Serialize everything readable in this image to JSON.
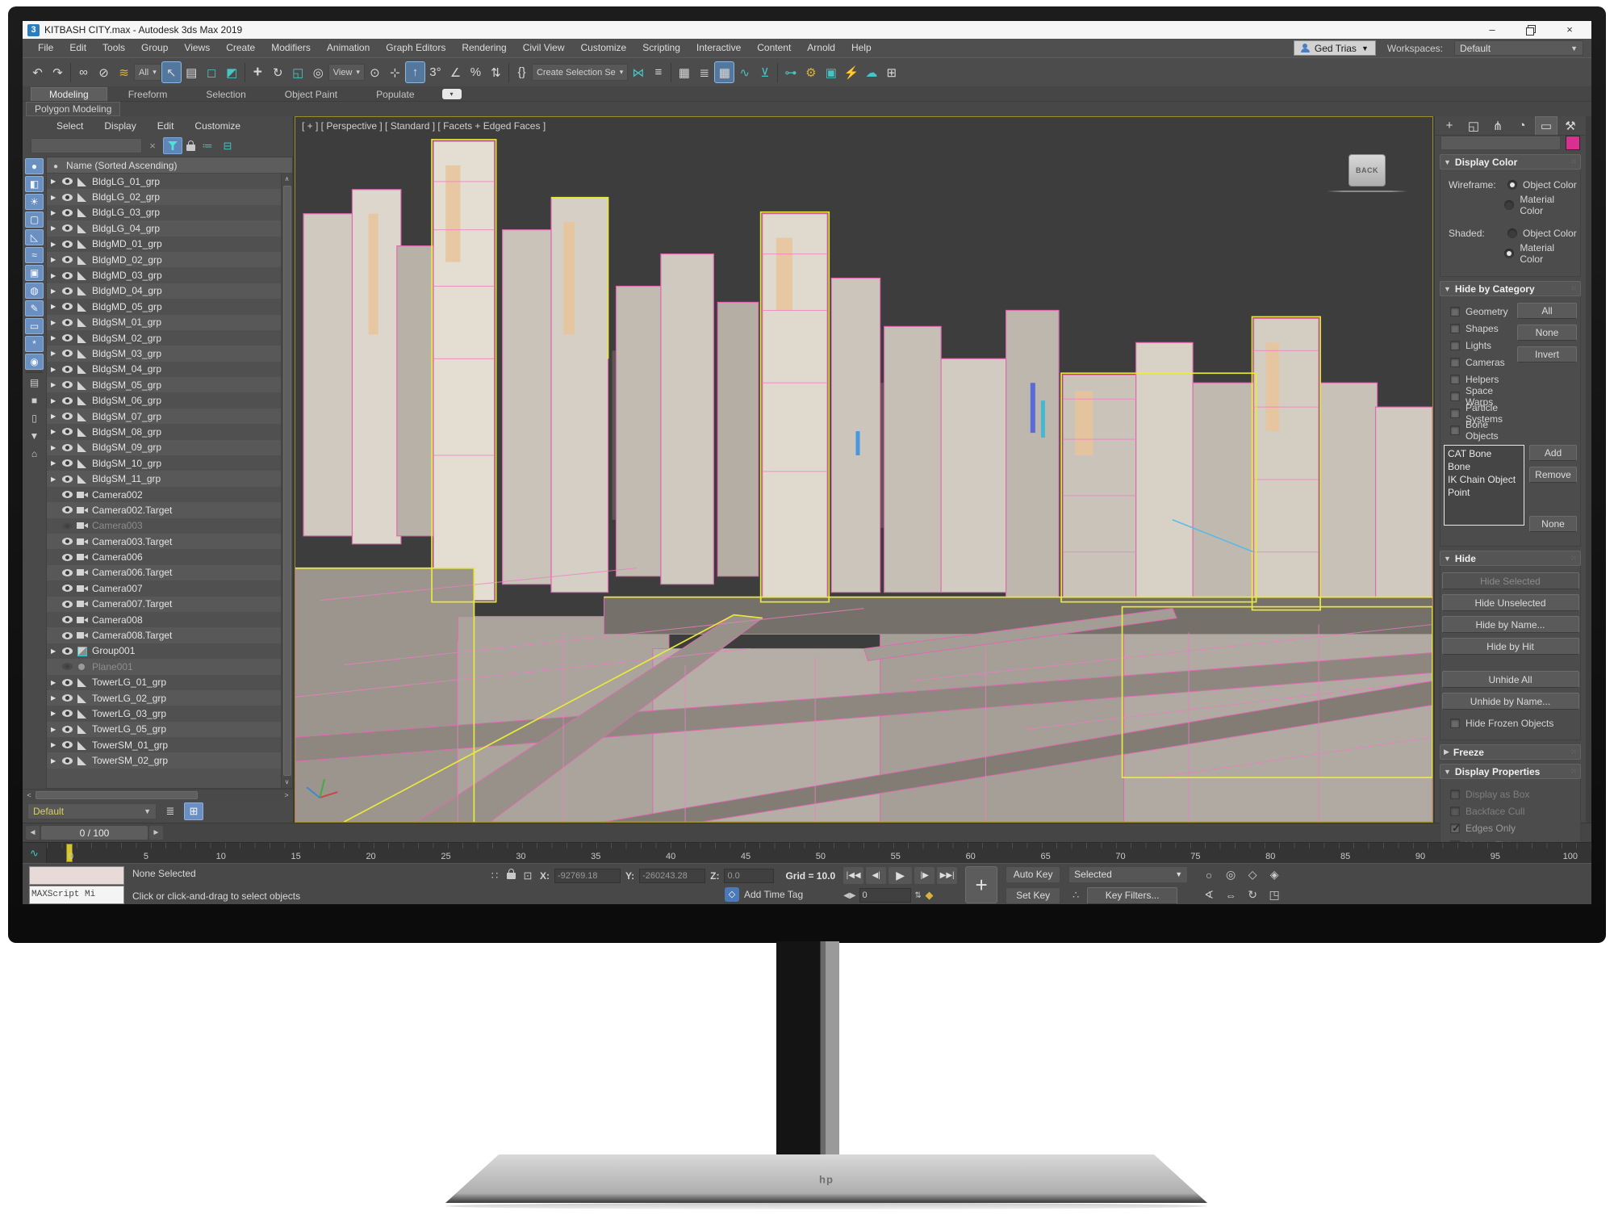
{
  "colors": {
    "accent_blue": "#6a90c2",
    "teal": "#49c3c3",
    "magenta_swatch": "#d92f8f",
    "selection_yellow": "#e9e93c",
    "wire_pink": "#e06ab0",
    "timeline_marker": "#d6c62e"
  },
  "titlebar": {
    "app_glyph": "3",
    "title": "KITBASH CITY.max - Autodesk 3ds Max 2019"
  },
  "menubar": {
    "items": [
      "File",
      "Edit",
      "Tools",
      "Group",
      "Views",
      "Create",
      "Modifiers",
      "Animation",
      "Graph Editors",
      "Rendering",
      "Civil View",
      "Customize",
      "Scripting",
      "Interactive",
      "Content",
      "Arnold",
      "Help"
    ],
    "user": "Ged Trias",
    "workspaces_label": "Workspaces:",
    "workspace": "Default"
  },
  "toolbar": {
    "items": [
      {
        "g": "↶",
        "n": "undo-icon"
      },
      {
        "g": "↷",
        "n": "redo-icon"
      },
      {
        "g": "",
        "n": "separator",
        "c": "sep"
      },
      {
        "g": "∞",
        "n": "select-and-link-icon"
      },
      {
        "g": "⊘",
        "n": "unlink-selection-icon"
      },
      {
        "g": "≋",
        "n": "bind-to-space-warp-icon",
        "c": "yel"
      },
      {
        "g": "All",
        "n": "selection-filter-dropdown",
        "c": "dd w60"
      },
      {
        "g": "↖",
        "n": "select-object-icon",
        "c": "hl"
      },
      {
        "g": "▤",
        "n": "select-by-name-icon"
      },
      {
        "g": "◻",
        "n": "rectangular-selection-region-icon",
        "c": "teal"
      },
      {
        "g": "◩",
        "n": "crossing-selection-icon",
        "c": "teal"
      },
      {
        "g": "",
        "n": "separator",
        "c": "sep"
      },
      {
        "g": "+",
        "n": "select-and-move-icon",
        "c": "big"
      },
      {
        "g": "↻",
        "n": "select-and-rotate-icon"
      },
      {
        "g": "◱",
        "n": "select-and-scale-icon",
        "c": "teal"
      },
      {
        "g": "◎",
        "n": "select-and-place-icon"
      },
      {
        "g": "View",
        "n": "reference-coordinate-dropdown",
        "c": "dd w74"
      },
      {
        "g": "⊙",
        "n": "use-pivot-center-icon"
      },
      {
        "g": "⊹",
        "n": "select-and-manipulate-icon"
      },
      {
        "g": "↑",
        "n": "keyboard-shortcut-override-icon",
        "c": "hl"
      },
      {
        "g": "3°",
        "n": "snaps-toggle-3d-icon"
      },
      {
        "g": "∠",
        "n": "angle-snap-icon"
      },
      {
        "g": "%",
        "n": "percent-snap-icon"
      },
      {
        "g": "⇅",
        "n": "spinner-snap-icon"
      },
      {
        "g": "",
        "n": "separator",
        "c": "sep"
      },
      {
        "g": "{}",
        "n": "edit-named-selection-sets-icon"
      },
      {
        "g": "Create Selection Se",
        "n": "named-selection-set-dropdown",
        "c": "dd w128"
      },
      {
        "g": "⋈",
        "n": "mirror-icon",
        "c": "teal"
      },
      {
        "g": "≡",
        "n": "align-icon"
      },
      {
        "g": "",
        "n": "separator",
        "c": "sep"
      },
      {
        "g": "▦",
        "n": "toggle-scene-explorer-icon"
      },
      {
        "g": "≣",
        "n": "toggle-layer-explorer-icon"
      },
      {
        "g": "▦",
        "n": "toggle-ribbon-icon",
        "c": "hl"
      },
      {
        "g": "∿",
        "n": "curve-editor-icon",
        "c": "teal"
      },
      {
        "g": "⊻",
        "n": "schematic-view-icon",
        "c": "teal"
      },
      {
        "g": "",
        "n": "separator",
        "c": "sep"
      },
      {
        "g": "⊶",
        "n": "material-editor-icon",
        "c": "teal"
      },
      {
        "g": "⚙",
        "n": "render-setup-icon",
        "c": "yel"
      },
      {
        "g": "▣",
        "n": "rendered-frame-window-icon",
        "c": "teal"
      },
      {
        "g": "⚡",
        "n": "render-production-icon",
        "c": "teal"
      },
      {
        "g": "☁",
        "n": "render-in-cloud-icon",
        "c": "teal"
      },
      {
        "g": "⊞",
        "n": "compare-renders-icon"
      }
    ]
  },
  "ribbon": {
    "tabs": [
      {
        "label": "Modeling",
        "c": "active"
      },
      {
        "label": "Freeform"
      },
      {
        "label": "Selection"
      },
      {
        "label": "Object Paint"
      },
      {
        "label": "Populate"
      }
    ],
    "dd_glyph": "▾",
    "panel": "Polygon Modeling"
  },
  "explorer": {
    "menus": [
      "Select",
      "Display",
      "Edit",
      "Customize"
    ],
    "header": "Name (Sorted Ascending)",
    "strip": [
      {
        "g": "●",
        "n": "filter-selection-icon",
        "c": "blue"
      },
      {
        "g": "◧",
        "n": "filter-geometry-icon",
        "c": "blue"
      },
      {
        "g": "☀",
        "n": "filter-lights-icon",
        "c": "blue"
      },
      {
        "g": "▢",
        "n": "filter-cameras-icon",
        "c": "blue"
      },
      {
        "g": "◺",
        "n": "filter-shapes-icon",
        "c": "blue"
      },
      {
        "g": "≈",
        "n": "filter-space-warps-icon",
        "c": "blue"
      },
      {
        "g": "▣",
        "n": "filter-materials-icon",
        "c": "blue"
      },
      {
        "g": "◍",
        "n": "filter-helpers-icon",
        "c": "blue"
      },
      {
        "g": "✎",
        "n": "filter-bones-icon",
        "c": "blue"
      },
      {
        "g": "▭",
        "n": "filter-containers-icon",
        "c": "blue"
      },
      {
        "g": "*",
        "n": "filter-particles-icon",
        "c": "blue"
      },
      {
        "g": "◉",
        "n": "filter-visibility-icon",
        "c": "blue"
      },
      {
        "g": "",
        "n": "strip-divider",
        "c": "div"
      },
      {
        "g": "▤",
        "n": "list-view-icon",
        "c": "dark"
      },
      {
        "g": "■",
        "n": "box-mode-icon",
        "c": "dark"
      },
      {
        "g": "▯",
        "n": "notes-icon",
        "c": "dark"
      },
      {
        "g": "▼",
        "n": "funnel-icon",
        "c": "dark"
      },
      {
        "g": "⌂",
        "n": "container-icon",
        "c": "dark"
      }
    ],
    "rows": [
      {
        "name": "BldgLG_01_grp",
        "cls": "grp"
      },
      {
        "name": "BldgLG_02_grp",
        "cls": "grp"
      },
      {
        "name": "BldgLG_03_grp",
        "cls": "grp"
      },
      {
        "name": "BldgLG_04_grp",
        "cls": "grp"
      },
      {
        "name": "BldgMD_01_grp",
        "cls": "grp"
      },
      {
        "name": "BldgMD_02_grp",
        "cls": "grp"
      },
      {
        "name": "BldgMD_03_grp",
        "cls": "grp"
      },
      {
        "name": "BldgMD_04_grp",
        "cls": "grp"
      },
      {
        "name": "BldgMD_05_grp",
        "cls": "grp"
      },
      {
        "name": "BldgSM_01_grp",
        "cls": "grp"
      },
      {
        "name": "BldgSM_02_grp",
        "cls": "grp"
      },
      {
        "name": "BldgSM_03_grp",
        "cls": "grp"
      },
      {
        "name": "BldgSM_04_grp",
        "cls": "grp"
      },
      {
        "name": "BldgSM_05_grp",
        "cls": "grp"
      },
      {
        "name": "BldgSM_06_grp",
        "cls": "grp"
      },
      {
        "name": "BldgSM_07_grp",
        "cls": "grp"
      },
      {
        "name": "BldgSM_08_grp",
        "cls": "grp"
      },
      {
        "name": "BldgSM_09_grp",
        "cls": "grp"
      },
      {
        "name": "BldgSM_10_grp",
        "cls": "grp"
      },
      {
        "name": "BldgSM_11_grp",
        "cls": "grp"
      },
      {
        "name": "Camera002",
        "cls": "cam"
      },
      {
        "name": "Camera002.Target",
        "cls": "cam"
      },
      {
        "name": "Camera003",
        "cls": "cam hid"
      },
      {
        "name": "Camera003.Target",
        "cls": "cam"
      },
      {
        "name": "Camera006",
        "cls": "cam"
      },
      {
        "name": "Camera006.Target",
        "cls": "cam"
      },
      {
        "name": "Camera007",
        "cls": "cam"
      },
      {
        "name": "Camera007.Target",
        "cls": "cam"
      },
      {
        "name": "Camera008",
        "cls": "cam"
      },
      {
        "name": "Camera008.Target",
        "cls": "cam"
      },
      {
        "name": "Group001",
        "cls": "grpbox"
      },
      {
        "name": "Plane001",
        "cls": "plane hid"
      },
      {
        "name": "TowerLG_01_grp",
        "cls": "grp"
      },
      {
        "name": "TowerLG_02_grp",
        "cls": "grp"
      },
      {
        "name": "TowerLG_03_grp",
        "cls": "grp"
      },
      {
        "name": "TowerLG_05_grp",
        "cls": "grp"
      },
      {
        "name": "TowerSM_01_grp",
        "cls": "grp"
      },
      {
        "name": "TowerSM_02_grp",
        "cls": "grp"
      }
    ],
    "view_preset": "Default"
  },
  "viewport": {
    "label": "[ + ] [ Perspective ] [ Standard ] [ Facets + Edged Faces ]",
    "viewcube": "BACK"
  },
  "panel": {
    "tabs": [
      {
        "g": "+",
        "n": "create-tab"
      },
      {
        "g": "◱",
        "n": "modify-tab"
      },
      {
        "g": "⋔",
        "n": "hierarchy-tab"
      },
      {
        "g": "◔",
        "n": "motion-tab"
      },
      {
        "g": "▭",
        "n": "display-tab",
        "c": "active"
      },
      {
        "g": "⚒",
        "n": "utilities-tab"
      }
    ],
    "display_color": {
      "title": "Display Color",
      "wireframe_label": "Wireframe:",
      "shaded_label": "Shaded:",
      "object_color": "Object Color",
      "material_color": "Material Color",
      "wireframe_selected": "Object Color",
      "shaded_selected": "Material Color"
    },
    "hide_by_category": {
      "title": "Hide by Category",
      "categories": [
        {
          "label": "Geometry"
        },
        {
          "label": "Shapes"
        },
        {
          "label": "Lights"
        },
        {
          "label": "Cameras"
        },
        {
          "label": "Helpers"
        },
        {
          "label": "Space Warps"
        },
        {
          "label": "Particle Systems"
        },
        {
          "label": "Bone Objects"
        }
      ],
      "buttons": [
        {
          "label": "All"
        },
        {
          "label": "None"
        },
        {
          "label": "Invert"
        }
      ],
      "list": [
        "CAT Bone",
        "Bone",
        "IK Chain Object",
        "Point"
      ],
      "list_buttons": [
        {
          "label": "Add"
        },
        {
          "label": "Remove"
        },
        {
          "label": "None",
          "c": "gap"
        }
      ]
    },
    "hide": {
      "title": "Hide",
      "buttons": [
        {
          "label": "Hide Selected",
          "c": "disabled"
        },
        {
          "label": "Hide Unselected"
        },
        {
          "label": "Hide by Name..."
        },
        {
          "label": "Hide by Hit"
        },
        {
          "label": "Unhide All",
          "c": "gap"
        },
        {
          "label": "Unhide by Name..."
        }
      ],
      "checkbox": "Hide Frozen Objects"
    },
    "freeze": {
      "title": "Freeze"
    },
    "display_properties": {
      "title": "Display Properties",
      "items": [
        {
          "label": "Display as Box",
          "c": "disabled"
        },
        {
          "label": "Backface Cull",
          "c": "disabled"
        },
        {
          "label": "Edges Only",
          "c": "dim",
          "box": "checked"
        },
        {
          "label": "Vertex Ticks",
          "c": "disabled"
        }
      ]
    }
  },
  "timeline": {
    "slider_value": "0 / 100",
    "ticks": [
      "0",
      "5",
      "10",
      "15",
      "20",
      "25",
      "30",
      "35",
      "40",
      "45",
      "50",
      "55",
      "60",
      "65",
      "70",
      "75",
      "80",
      "85",
      "90",
      "95",
      "100"
    ]
  },
  "statusbar": {
    "maxscript": "MAXScript Mi",
    "selection": "None Selected",
    "prompt": "Click or click-and-drag to select objects",
    "x_label": "X:",
    "x": "-92769.18",
    "y_label": "Y:",
    "y": "-260243.28",
    "z_label": "Z:",
    "z": "0.0",
    "grid": "Grid = 10.0",
    "add_time_tag": "Add Time Tag",
    "playback": [
      {
        "g": "|◀◀",
        "n": "go-to-start-button"
      },
      {
        "g": "◀|",
        "n": "previous-frame-button"
      },
      {
        "g": "▶",
        "n": "play-button",
        "c": "play"
      },
      {
        "g": "|▶",
        "n": "next-frame-button"
      },
      {
        "g": "▶▶|",
        "n": "go-to-end-button"
      }
    ],
    "frame": "0",
    "auto_key": "Auto Key",
    "set_key": "Set Key",
    "selected_dropdown": "Selected",
    "key_filters": "Key Filters...",
    "nav": [
      {
        "g": "○",
        "n": "zoom-icon"
      },
      {
        "g": "◎",
        "n": "zoom-all-icon"
      },
      {
        "g": "◇",
        "n": "zoom-extents-icon"
      },
      {
        "g": "◈",
        "n": "zoom-extents-all-icon"
      },
      {
        "g": "∢",
        "n": "field-of-view-icon"
      },
      {
        "g": "⇔",
        "n": "pan-icon"
      },
      {
        "g": "↻",
        "n": "orbit-icon"
      },
      {
        "g": "◳",
        "n": "maximize-viewport-icon"
      }
    ]
  }
}
